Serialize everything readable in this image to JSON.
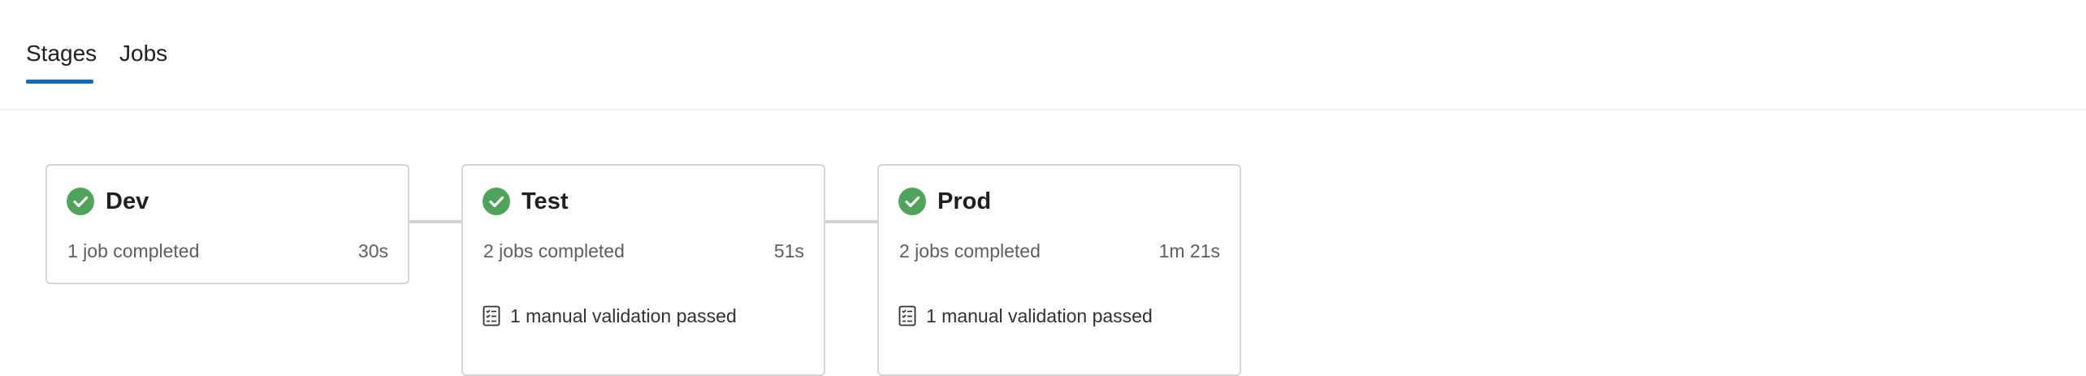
{
  "tabs": [
    {
      "label": "Stages",
      "selected": true
    },
    {
      "label": "Jobs",
      "selected": false
    }
  ],
  "colors": {
    "accent": "#0f6cbd",
    "success": "#4fa35a",
    "border": "#d6d6d6",
    "secondary_text": "#605e5c"
  },
  "stages": [
    {
      "name": "Dev",
      "status_icon": "check-circle-icon",
      "summary": "1 job completed",
      "duration": "30s"
    },
    {
      "name": "Test",
      "status_icon": "check-circle-icon",
      "summary": "2 jobs completed",
      "duration": "51s",
      "validation": {
        "icon": "checklist-icon",
        "label": "1 manual validation passed"
      }
    },
    {
      "name": "Prod",
      "status_icon": "check-circle-icon",
      "summary": "2 jobs completed",
      "duration": "1m 21s",
      "validation": {
        "icon": "checklist-icon",
        "label": "1 manual validation passed"
      }
    }
  ]
}
